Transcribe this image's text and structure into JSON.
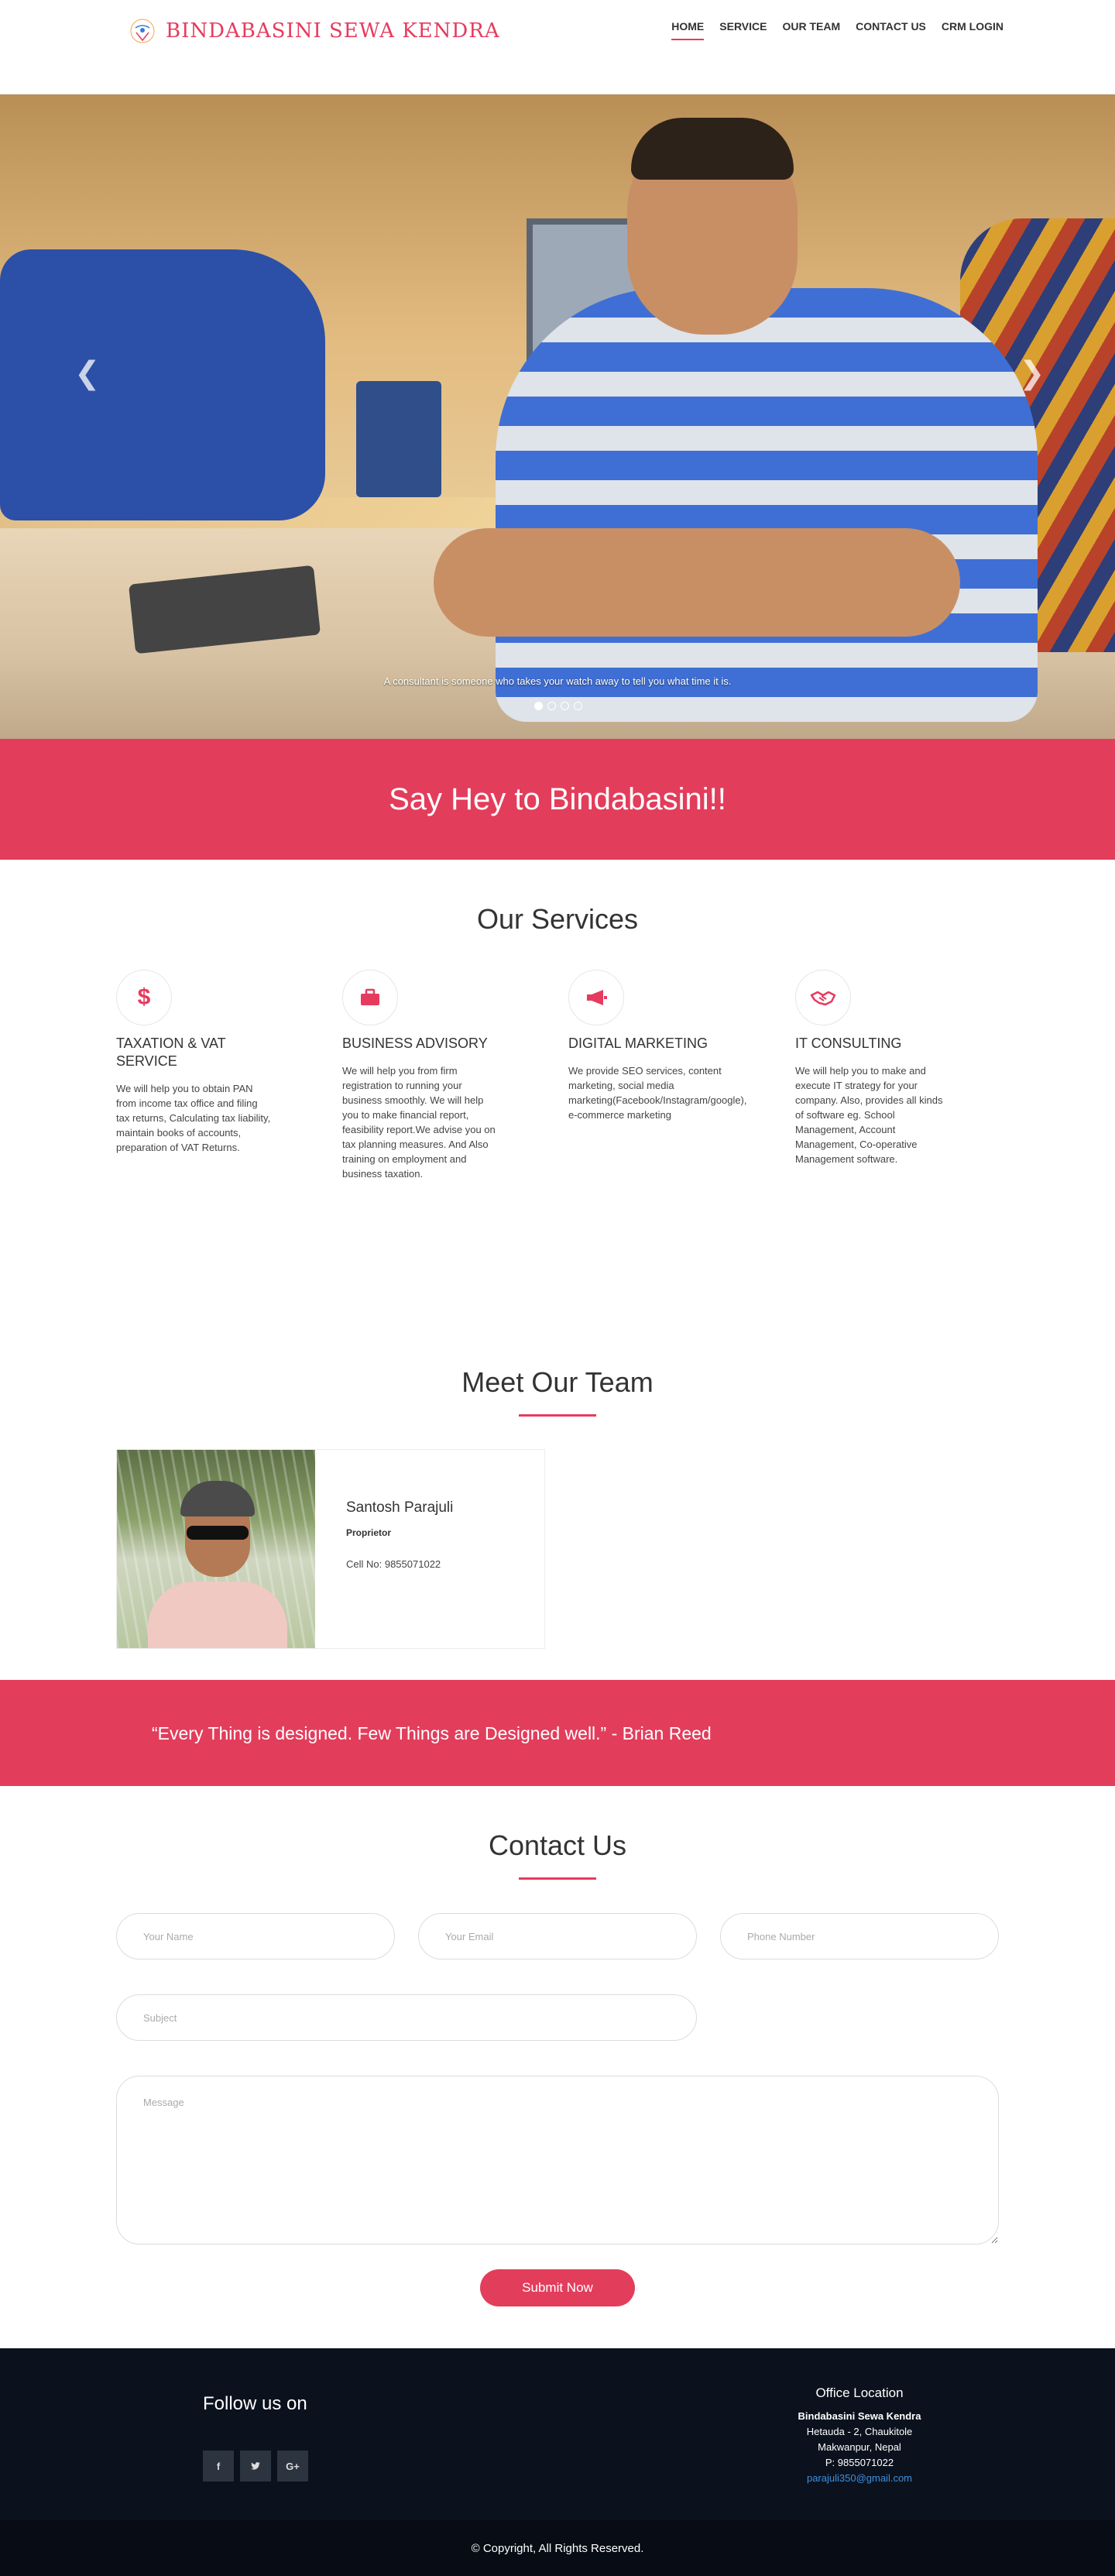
{
  "navbar": {
    "brand_name": "BINDABASINI SEWA KENDRA",
    "links": [
      {
        "label": "HOME"
      },
      {
        "label": "SERVICE"
      },
      {
        "label": "OUR TEAM"
      },
      {
        "label": "CONTACT US"
      },
      {
        "label": "CRM LOGIN"
      }
    ]
  },
  "carousel": {
    "caption": "A consultant is someone who takes your watch away to tell you what time it is.",
    "left_icon": "chevron-left-icon",
    "right_icon": "chevron-right-icon",
    "slide_count": 4,
    "active_slide": 1
  },
  "hey": {
    "text": "Say Hey to Bindabasini!!"
  },
  "services": {
    "title": "Our Services",
    "items": [
      {
        "icon": "dollar-icon",
        "title": "TAXATION & VAT SERVICE",
        "description": "We will help you to obtain PAN from income tax office and filing tax returns, Calculating tax liability, maintain books of accounts, preparation of VAT Returns."
      },
      {
        "icon": "briefcase-icon",
        "title": "BUSINESS ADVISORY",
        "description": "We will help you from firm registration to running your business smoothly. We will help you to make financial report, feasibility report.We advise you on tax planning measures. And Also training on employment and business taxation."
      },
      {
        "icon": "megaphone-icon",
        "title": "DIGITAL MARKETING",
        "description": "We provide SEO services, content marketing, social media marketing(Facebook/Instagram/google), e-commerce marketing"
      },
      {
        "icon": "handshake-icon",
        "title": "IT CONSULTING",
        "description": "We will help you to make and execute IT strategy for your company. Also, provides all kinds of software eg. School Management, Account Management, Co-operative Management software."
      }
    ]
  },
  "team": {
    "title": "Meet Our Team",
    "members": [
      {
        "name": "Santosh Parajuli",
        "role": "Proprietor",
        "cell": "Cell No: 9855071022"
      }
    ]
  },
  "quote": {
    "text": "“Every Thing is designed. Few Things are Designed well.” - Brian Reed"
  },
  "contact": {
    "title": "Contact Us",
    "name_placeholder": "Your Name",
    "email_placeholder": "Your Email",
    "phone_placeholder": "Phone Number",
    "subject_placeholder": "Subject",
    "message_placeholder": "Message",
    "submit_label": "Submit Now"
  },
  "footer": {
    "follow_title": "Follow us on",
    "social": [
      {
        "icon": "facebook-icon",
        "glyph": "f"
      },
      {
        "icon": "twitter-icon",
        "glyph": "ʃ"
      },
      {
        "icon": "google-plus-icon",
        "glyph": "G+"
      }
    ],
    "office": {
      "title": "Office Location",
      "name": "Bindabasini Sewa Kendra",
      "address1": "Hetauda - 2, Chaukitole",
      "address2": "Makwanpur, Nepal",
      "phone": "P: 9855071022",
      "email": "parajuli350@gmail.com"
    },
    "copyright": "© Copyright, All Rights Reserved."
  },
  "colors": {
    "accent": "#e33d5c",
    "footer_bg": "#0b121d"
  }
}
